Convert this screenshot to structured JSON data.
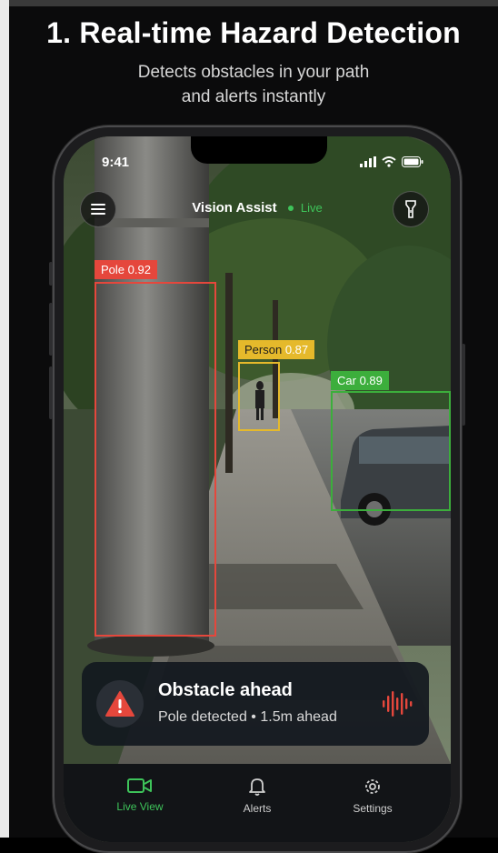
{
  "promo": {
    "headline": "1. Real-time Hazard Detection",
    "subhead_line1": "Detects obstacles in your path",
    "subhead_line2": "and alerts instantly"
  },
  "status_bar": {
    "time": "9:41"
  },
  "app_header": {
    "title": "Vision Assist",
    "live_label": "Live"
  },
  "detections": [
    {
      "label": "Pole",
      "confidence": "0.92",
      "color": "#e5473c"
    },
    {
      "label": "Person",
      "confidence": "0.87",
      "color": "#e5b92b"
    },
    {
      "label": "Car",
      "confidence": "0.89",
      "color": "#3cae3c"
    }
  ],
  "alert": {
    "title": "Obstacle ahead",
    "subtitle": "Pole detected • 1.5m ahead",
    "color": "#e5473c"
  },
  "tabs": [
    {
      "label": "Live View",
      "icon": "video-camera-icon",
      "active": true
    },
    {
      "label": "Alerts",
      "icon": "bell-icon",
      "active": false
    },
    {
      "label": "Settings",
      "icon": "gear-icon",
      "active": false
    }
  ],
  "colors": {
    "accent_green": "#3ec45a",
    "background": "#0b0b0c"
  }
}
